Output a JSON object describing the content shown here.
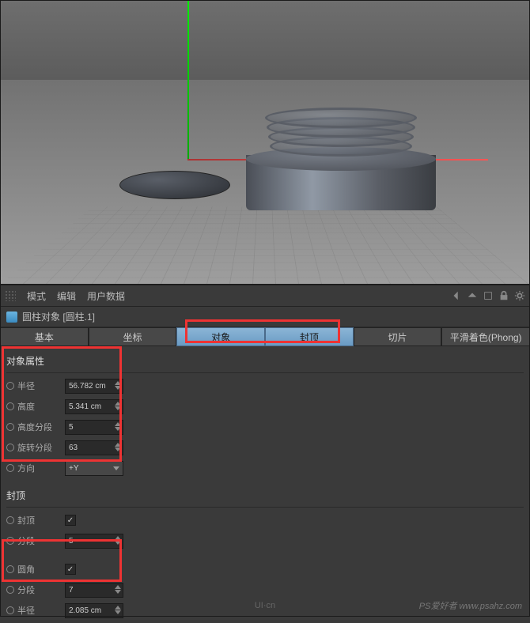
{
  "menu": {
    "mode": "模式",
    "edit": "编辑",
    "user_data": "用户数据"
  },
  "title": "圆柱对象 [圆柱.1]",
  "tabs": {
    "basic": "基本",
    "coord": "坐标",
    "object": "对象",
    "cap": "封顶",
    "slice": "切片",
    "phong": "平滑着色(Phong)"
  },
  "section_object": "对象属性",
  "section_cap": "封顶",
  "props_object": {
    "radius": {
      "label": "半径",
      "value": "56.782 cm"
    },
    "height": {
      "label": "高度",
      "value": "5.341 cm"
    },
    "height_seg": {
      "label": "高度分段",
      "value": "5"
    },
    "rot_seg": {
      "label": "旋转分段",
      "value": "63"
    },
    "direction": {
      "label": "方向",
      "value": "+Y"
    }
  },
  "props_cap": {
    "cap": {
      "label": "封顶",
      "checked": "✓"
    },
    "seg": {
      "label": "分段",
      "value": "5"
    },
    "fillet": {
      "label": "圆角",
      "checked": "✓"
    },
    "fillet_seg": {
      "label": "分段",
      "value": "7"
    },
    "fillet_radius": {
      "label": "半径",
      "value": "2.085 cm"
    }
  },
  "watermark": "UI·cn",
  "watermark_right": "PS爱好者 www.psahz.com"
}
